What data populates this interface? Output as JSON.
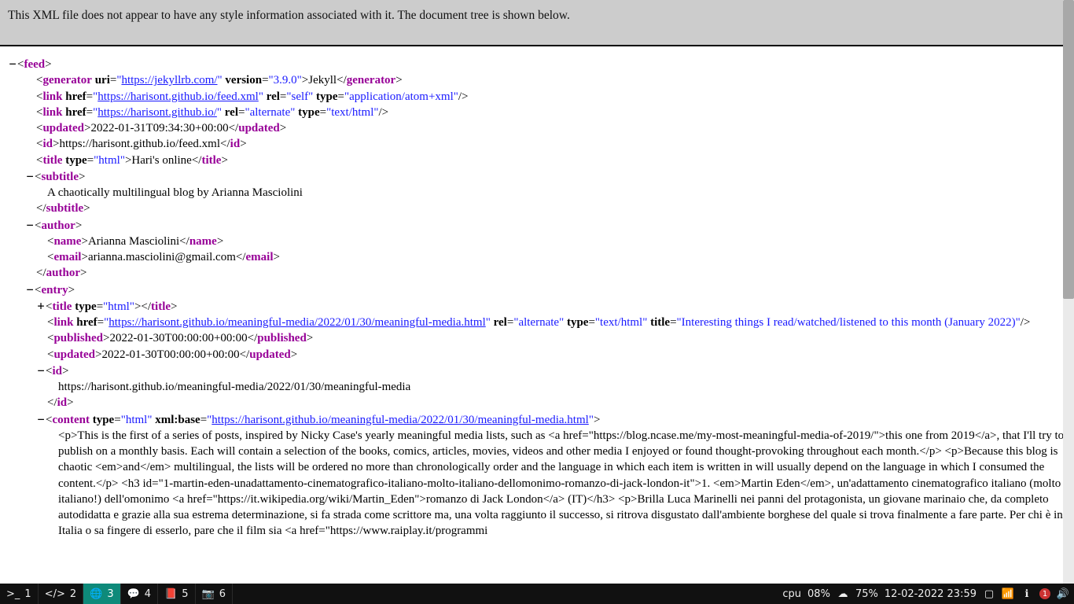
{
  "banner": {
    "message": "This XML file does not appear to have any style information associated with it. The document tree is shown below."
  },
  "xml": {
    "feed": {
      "generator": {
        "uri": "https://jekyllrb.com/",
        "version": "3.9.0",
        "text": "Jekyll"
      },
      "link1": {
        "href": "https://harisont.github.io/feed.xml",
        "rel": "self",
        "type": "application/atom+xml"
      },
      "link2": {
        "href": "https://harisont.github.io/",
        "rel": "alternate",
        "type": "text/html"
      },
      "updated": "2022-01-31T09:34:30+00:00",
      "id": "https://harisont.github.io/feed.xml",
      "title": {
        "type": "html",
        "text": "Hari's online"
      },
      "subtitle": "A chaotically multilingual blog by Arianna Masciolini",
      "author": {
        "name": "Arianna Masciolini",
        "email": "arianna.masciolini@gmail.com"
      },
      "entry": {
        "title_type": "html",
        "link": {
          "href": "https://harisont.github.io/meaningful-media/2022/01/30/meaningful-media.html",
          "rel": "alternate",
          "type": "text/html",
          "title": "Interesting things I read/watched/listened to this month (January 2022)"
        },
        "published": "2022-01-30T00:00:00+00:00",
        "updated": "2022-01-30T00:00:00+00:00",
        "id": "https://harisont.github.io/meaningful-media/2022/01/30/meaningful-media",
        "content": {
          "type": "html",
          "xmlbase": "https://harisont.github.io/meaningful-media/2022/01/30/meaningful-media.html"
        },
        "content_text": "<p>This is the first of a series of posts, inspired by Nicky Case's yearly meaningful media lists, such as <a href=\"https://blog.ncase.me/my-most-meaningful-media-of-2019/\">this one from 2019</a>, that I'll try to publish on a monthly basis. Each will contain a selection of the books, comics, articles, movies, videos and other media I enjoyed or found thought-provoking throughout each month.</p> <p>Because this blog is chaotic <em>and</em> multilingual, the lists will be ordered no more than chronologically order and the language in which each item is written in will usually depend on the language in which I consumed the content.</p> <h3 id=\"1-martin-eden-unadattamento-cinematografico-italiano-molto-italiano-dellomonimo-romanzo-di-jack-london-it\">1. <em>Martin Eden</em>, un'adattamento cinematografico italiano (molto italiano!) dell'omonimo <a href=\"https://it.wikipedia.org/wiki/Martin_Eden\">romanzo di Jack London</a> (IT)</h3> <p>Brilla Luca Marinelli nei panni del protagonista, un giovane marinaio che, da completo autodidatta e grazie alla sua estrema determinazione, si fa strada come scrittore ma, una volta raggiunto il successo, si ritrova disgustato dall'ambiente borghese del quale si trova finalmente a fare parte. Per chi è in Italia o sa fingere di esserlo, pare che il film sia <a href=\"https://www.raiplay.it/programmi"
      }
    }
  },
  "taskbar": {
    "items": [
      {
        "icon": ">_",
        "num": "1",
        "active": false
      },
      {
        "icon": "</>",
        "num": "2",
        "active": false
      },
      {
        "icon": "🌐",
        "num": "3",
        "active": true
      },
      {
        "icon": "💬",
        "num": "4",
        "active": false
      },
      {
        "icon": "📕",
        "num": "5",
        "active": false
      },
      {
        "icon": "📷",
        "num": "6",
        "active": false
      }
    ],
    "cpu_label": "cpu",
    "cpu": "08%",
    "cloud": "75%",
    "datetime": "12-02-2022 23:59",
    "wifi_badge": "1"
  }
}
